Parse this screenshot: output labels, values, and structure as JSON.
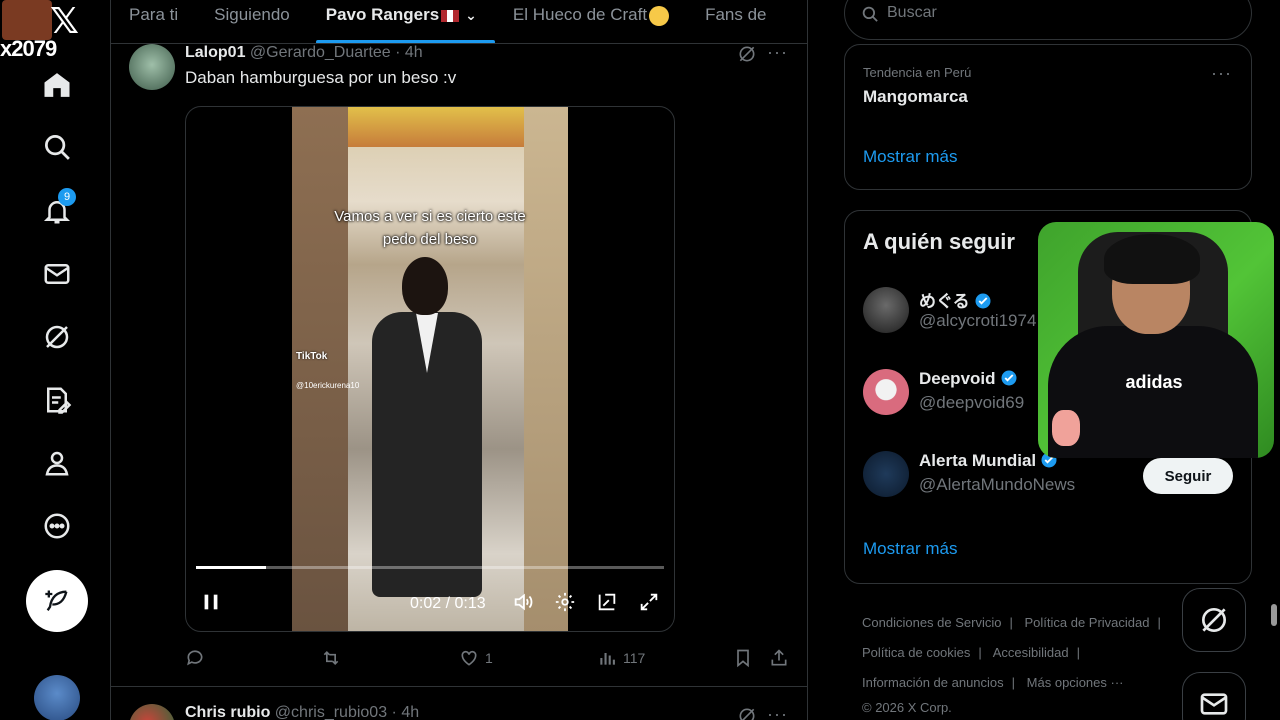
{
  "streamer": {
    "name": "x2079"
  },
  "nav": {
    "notification_count": "9",
    "items": [
      "home-icon",
      "explore-icon",
      "notifications-icon",
      "messages-icon",
      "grok-icon",
      "lists-icon",
      "profile-icon",
      "more-icon"
    ]
  },
  "tabs": [
    {
      "label": "Para ti"
    },
    {
      "label": "Siguiendo"
    },
    {
      "label": "Pavo Rangers"
    },
    {
      "label": "El Hueco de Craft"
    },
    {
      "label": "Fans de"
    }
  ],
  "tweet1": {
    "name": "Lalop01",
    "handle": "@Gerardo_Duartee · 4h",
    "text": "Daban hamburguesa por un beso :v",
    "video": {
      "caption_line1": "Vamos a ver si es cierto este",
      "caption_line2": "pedo del beso",
      "watermark": "TikTok",
      "watermark_handle": "@10erickurena10",
      "time": "0:02 / 0:13",
      "progress": 0.15
    },
    "likes": "1",
    "views": "117"
  },
  "tweet2": {
    "name": "Chris rubio",
    "handle": "@chris_rubio03 · 4h"
  },
  "search": {
    "placeholder": "Buscar"
  },
  "trend": {
    "category": "Tendencia en Perú",
    "name": "Mangomarca",
    "show_more": "Mostrar más"
  },
  "who_to_follow": {
    "title": "A quién seguir",
    "accounts": [
      {
        "name": "めぐる",
        "handle": "@alcycroti1974"
      },
      {
        "name": "Deepvoid",
        "handle": "@deepvoid69"
      },
      {
        "name": "Alerta Mundial",
        "handle": "@AlertaMundoNews"
      }
    ],
    "follow_label": "Seguir",
    "show_more": "Mostrar más"
  },
  "footer": {
    "links": [
      "Condiciones de Servicio",
      "Política de Privacidad",
      "Política de cookies",
      "Accesibilidad",
      "Información de anuncios",
      "Más opciones ···"
    ],
    "copyright": "© 2026 X Corp."
  },
  "webcam": {
    "shirt_logo": "adidas"
  },
  "colors": {
    "accent": "#1d9bf0",
    "background": "#000000",
    "muted": "#71767b",
    "border": "#2f3336"
  }
}
